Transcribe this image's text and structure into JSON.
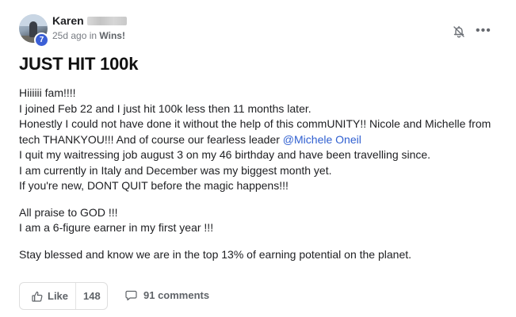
{
  "author": {
    "name": "Karen",
    "level": "7",
    "time_ago": "25d ago in",
    "category": "Wins!"
  },
  "post": {
    "title": "JUST HIT 100k",
    "lines": [
      "Hiiiiii fam!!!!",
      "I joined Feb 22 and I just hit 100k less then 11 months later.",
      "Honestly I could not have done it without the help of this commUNITY!! Nicole and Michelle from",
      "tech THANKYOU!!! And of course our fearless leader ",
      "@Michele Oneil",
      "I quit my waitressing job august 3 on my 46 birthday and have been travelling since.",
      "I am currently in Italy and December was my biggest month yet.",
      "If you're new, DONT QUIT before the magic happens!!!",
      "All praise to GOD !!!",
      "I am a 6-figure earner in my first year !!!",
      "Stay blessed and know we are in the top 13% of earning potential on the planet."
    ]
  },
  "actions": {
    "like_label": "Like",
    "like_count": "148",
    "comments_label": "91 comments",
    "more_label": "•••"
  },
  "colors": {
    "mention": "#2f5fd0",
    "badge": "#3b5fd6"
  },
  "icons": {
    "bell": "bell-off-icon",
    "more": "more-horizontal-icon",
    "like": "thumbs-up-icon",
    "comment": "comment-icon"
  }
}
